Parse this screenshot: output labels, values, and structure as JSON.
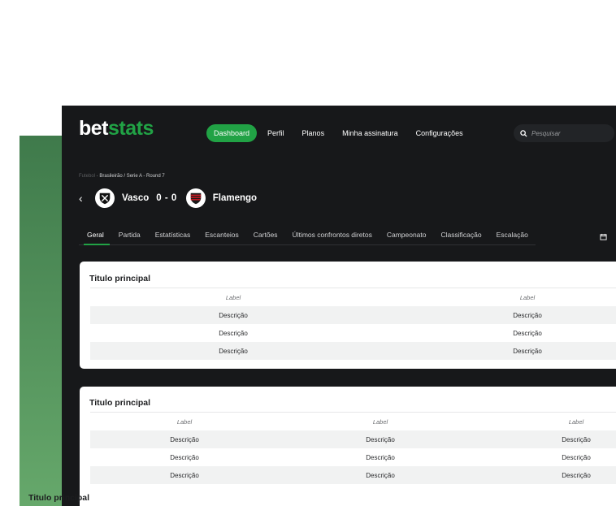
{
  "logo": {
    "part1": "bet",
    "part2": "stats"
  },
  "nav": {
    "items": [
      "Dashboard",
      "Perfil",
      "Planos",
      "Minha assinatura",
      "Configurações"
    ],
    "active": "Dashboard"
  },
  "search": {
    "placeholder": "Pesquisar",
    "icon": "search-icon"
  },
  "breadcrumb": {
    "root": "Futebol",
    "path": "Brasileirão / Serie A - Round 7"
  },
  "match": {
    "home": "Vasco",
    "away": "Flamengo",
    "score": "0 - 0"
  },
  "tabs": [
    "Geral",
    "Partida",
    "Estatísticas",
    "Escanteios",
    "Cartões",
    "Últimos confrontos diretos",
    "Campeonato",
    "Classificação",
    "Escalação"
  ],
  "cards": [
    {
      "title": "Titulo principal",
      "headers": [
        "Label",
        "Label"
      ],
      "rows": [
        [
          "Descrição",
          "Descrição"
        ],
        [
          "Descrição",
          "Descrição"
        ],
        [
          "Descrição",
          "Descrição"
        ]
      ]
    },
    {
      "title": "Titulo principal",
      "headers": [
        "Label",
        "Label",
        "Label"
      ],
      "rows": [
        [
          "Descrição",
          "Descrição",
          "Descrição"
        ],
        [
          "Descrição",
          "Descrição",
          "Descrição"
        ],
        [
          "Descrição",
          "Descrição",
          "Descrição"
        ]
      ]
    },
    {
      "title": "Titulo principal"
    }
  ],
  "colors": {
    "accent": "#21a245",
    "app_bg": "#17181a",
    "deco_green": "#5a9e62"
  }
}
